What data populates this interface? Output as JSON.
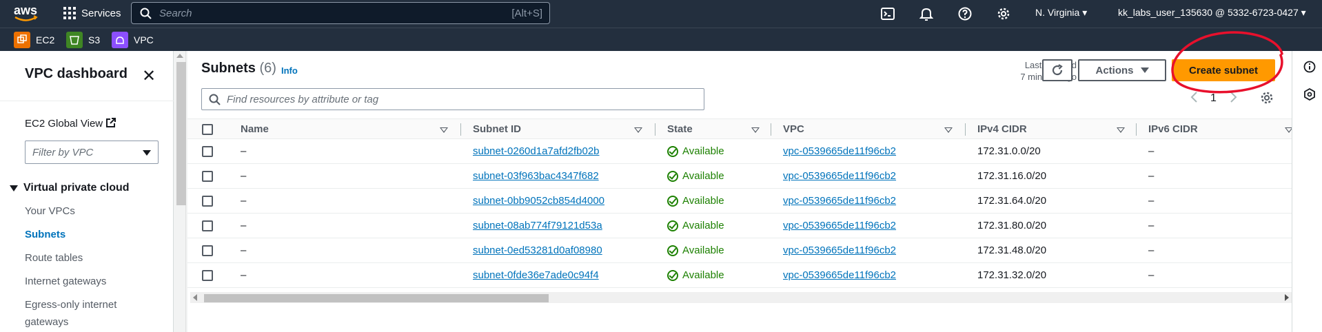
{
  "topbar": {
    "logo": "aws",
    "services_label": "Services",
    "search_placeholder": "Search",
    "search_shortcut": "[Alt+S]",
    "region": "N. Virginia",
    "account": "kk_labs_user_135630 @ 5332-6723-0427",
    "icons": [
      "cloudshell-icon",
      "notifications-icon",
      "help-icon",
      "settings-icon"
    ]
  },
  "favorites": [
    {
      "label": "EC2",
      "color": "#ed7100"
    },
    {
      "label": "S3",
      "color": "#3f8624"
    },
    {
      "label": "VPC",
      "color": "#8c4fff"
    }
  ],
  "sidebar": {
    "title": "VPC dashboard",
    "ec2_global_view": "EC2 Global View",
    "filter_placeholder": "Filter by VPC",
    "section": "Virtual private cloud",
    "items": [
      {
        "label": "Your VPCs",
        "active": false
      },
      {
        "label": "Subnets",
        "active": true
      },
      {
        "label": "Route tables",
        "active": false
      },
      {
        "label": "Internet gateways",
        "active": false
      },
      {
        "label": "Egress-only internet gateways",
        "active": false
      }
    ]
  },
  "main": {
    "title": "Subnets",
    "count": "(6)",
    "info": "Info",
    "last_updated_line1": "Last updated",
    "last_updated_line2": "7 minutes ago",
    "actions_label": "Actions",
    "create_label": "Create subnet",
    "filter_placeholder": "Find resources by attribute or tag",
    "page_number": "1",
    "columns": [
      "Name",
      "Subnet ID",
      "State",
      "VPC",
      "IPv4 CIDR",
      "IPv6 CIDR"
    ],
    "rows": [
      {
        "name": "–",
        "subnet_id": "subnet-0260d1a7afd2fb02b",
        "state": "Available",
        "vpc": "vpc-0539665de11f96cb2",
        "ipv4": "172.31.0.0/20",
        "ipv6": "–"
      },
      {
        "name": "–",
        "subnet_id": "subnet-03f963bac4347f682",
        "state": "Available",
        "vpc": "vpc-0539665de11f96cb2",
        "ipv4": "172.31.16.0/20",
        "ipv6": "–"
      },
      {
        "name": "–",
        "subnet_id": "subnet-0bb9052cb854d4000",
        "state": "Available",
        "vpc": "vpc-0539665de11f96cb2",
        "ipv4": "172.31.64.0/20",
        "ipv6": "–"
      },
      {
        "name": "–",
        "subnet_id": "subnet-08ab774f79121d53a",
        "state": "Available",
        "vpc": "vpc-0539665de11f96cb2",
        "ipv4": "172.31.80.0/20",
        "ipv6": "–"
      },
      {
        "name": "–",
        "subnet_id": "subnet-0ed53281d0af08980",
        "state": "Available",
        "vpc": "vpc-0539665de11f96cb2",
        "ipv4": "172.31.48.0/20",
        "ipv6": "–"
      },
      {
        "name": "–",
        "subnet_id": "subnet-0fde36e7ade0c94f4",
        "state": "Available",
        "vpc": "vpc-0539665de11f96cb2",
        "ipv4": "172.31.32.0/20",
        "ipv6": "–"
      }
    ]
  },
  "colors": {
    "accent": "#ff9900",
    "link": "#0073bb",
    "available": "#1d8102",
    "topbar": "#232f3e",
    "annotation": "#e8102c"
  }
}
